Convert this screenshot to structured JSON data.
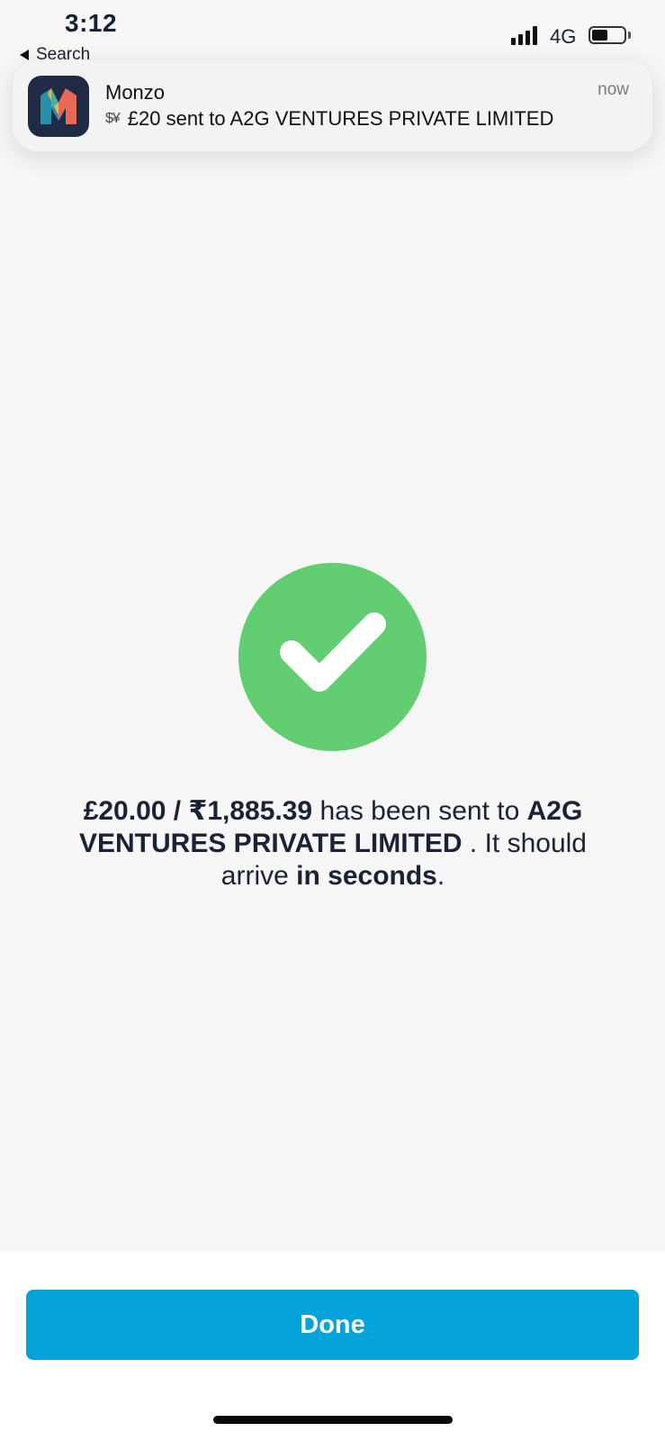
{
  "status_bar": {
    "time": "3:12",
    "back_label": "Search",
    "network": "4G"
  },
  "notification": {
    "app_name": "Monzo",
    "time": "now",
    "icon": "currency-exchange-icon",
    "icon_glyph": "$¥",
    "message": "£20 sent to A2G VENTURES PRIVATE LIMITED"
  },
  "success": {
    "icon": "checkmark-icon",
    "amount": "£20.00 / ₹1,885.39",
    "text_1": " has been sent to ",
    "recipient": "A2G VENTURES PRIVATE LIMITED",
    "text_2": " . It should arrive ",
    "eta": "in seconds",
    "text_3": "."
  },
  "done_button": {
    "label": "Done"
  },
  "colors": {
    "background": "#f6f6f6",
    "success_green": "#62cd71",
    "button_blue": "#04a3da",
    "text_dark": "#1b2236"
  }
}
